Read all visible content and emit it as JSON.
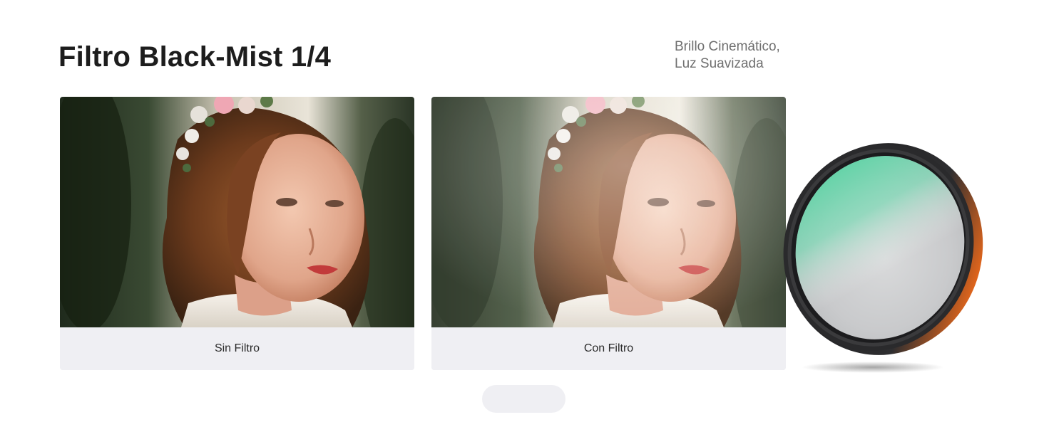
{
  "header": {
    "title": "Filtro Black-Mist 1/4",
    "tagline_line1": "Brillo Cinemático,",
    "tagline_line2": "Luz Suavizada"
  },
  "comparison": {
    "before_label": "Sin Filtro",
    "after_label": "Con Filtro"
  },
  "colors": {
    "card_bg": "#efeff3",
    "title": "#1d1d1d",
    "tagline": "#6f6f6f",
    "filter_coating": "#3fd59a",
    "filter_ring": "#2a2a2c",
    "filter_accent": "#e0651c"
  }
}
